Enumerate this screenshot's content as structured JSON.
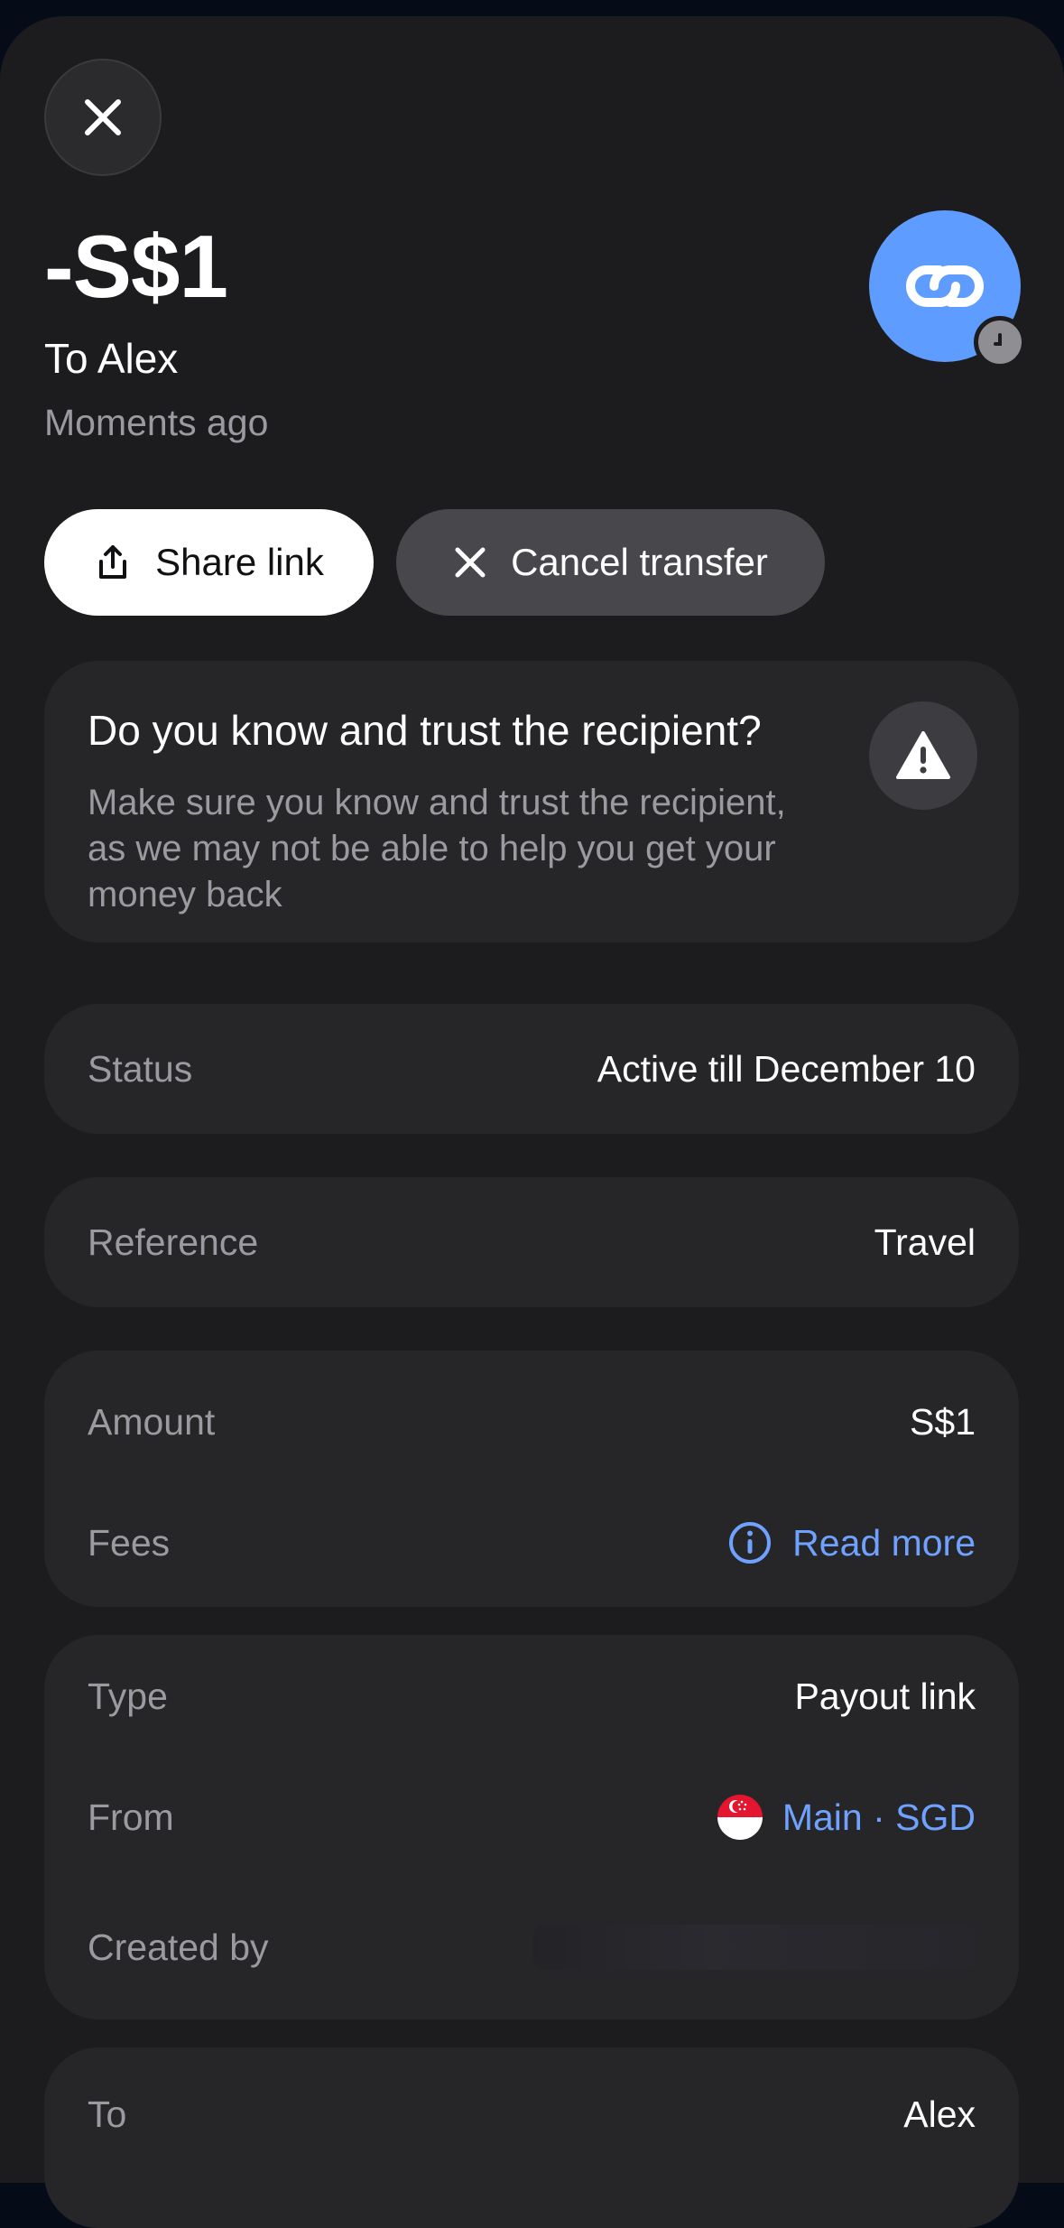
{
  "header": {
    "amount": "-S$1",
    "recipient_line": "To Alex",
    "time": "Moments ago"
  },
  "actions": {
    "share_label": "Share link",
    "cancel_label": "Cancel transfer"
  },
  "warning": {
    "title": "Do you know and trust the recipient?",
    "body": "Make sure you know and trust the recipient, as we may not be able to help you get your money back"
  },
  "details": {
    "status_label": "Status",
    "status_value": "Active till December 10",
    "reference_label": "Reference",
    "reference_value": "Travel",
    "amount_label": "Amount",
    "amount_value": "S$1",
    "fees_label": "Fees",
    "fees_link": "Read more",
    "type_label": "Type",
    "type_value": "Payout link",
    "from_label": "From",
    "from_value": "Main · SGD",
    "created_by_label": "Created by",
    "to_label": "To",
    "to_value": "Alex"
  },
  "icons": {
    "close": "close-icon",
    "link": "link-icon",
    "clock": "clock-icon",
    "share": "share-icon",
    "cancel": "x-icon",
    "warning": "warning-triangle-icon",
    "info": "info-icon",
    "flag": "singapore-flag-icon"
  },
  "colors": {
    "background": "#1c1c1e",
    "card": "#262629",
    "accent": "#5f9cff",
    "link": "#6fa2ff"
  }
}
